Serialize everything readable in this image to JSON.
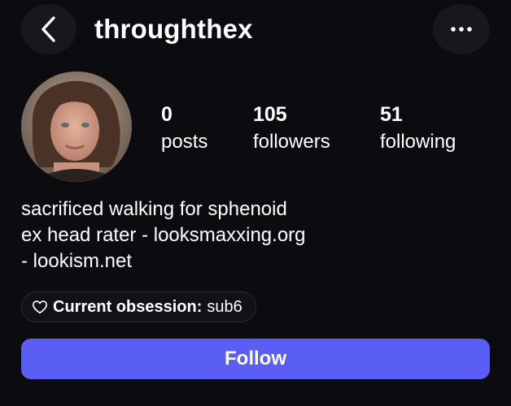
{
  "header": {
    "username": "throughthex",
    "back_icon": "chevron-left-icon",
    "more_icon": "more-horizontal-icon"
  },
  "profile": {
    "avatar_alt": "profile photo",
    "stats": [
      {
        "value": "0",
        "label": "posts"
      },
      {
        "value": "105",
        "label": "followers"
      },
      {
        "value": "51",
        "label": "following"
      }
    ],
    "bio_lines": [
      "sacrificed walking for sphenoid",
      "ex head rater - looksmaxxing.org",
      "- lookism.net"
    ],
    "obsession": {
      "icon": "heart-outline-icon",
      "label": "Current obsession:",
      "value": "sub6"
    }
  },
  "actions": {
    "follow_label": "Follow"
  },
  "colors": {
    "background": "#0c0c10",
    "button": "#5b5ef4",
    "text": "#ffffff"
  }
}
